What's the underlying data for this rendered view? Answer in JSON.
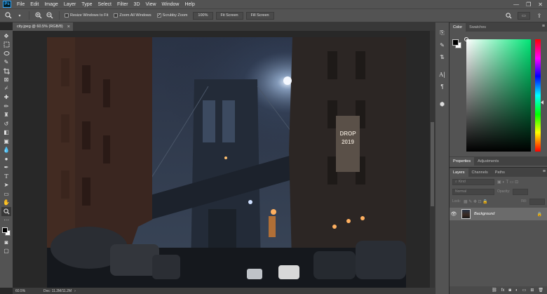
{
  "menubar": {
    "logo": "Ps",
    "items": [
      "File",
      "Edit",
      "Image",
      "Layer",
      "Type",
      "Select",
      "Filter",
      "3D",
      "View",
      "Window",
      "Help"
    ],
    "window_controls": [
      "—",
      "❐",
      "✕"
    ]
  },
  "options": {
    "resize_windows_label": "Resize Windows to Fit",
    "zoom_all_label": "Zoom All Windows",
    "scrubby_zoom_label": "Scrubby Zoom",
    "scrubby_checked": true,
    "zoom_pct_button": "100%",
    "fit_screen_button": "Fit Screen",
    "fill_screen_button": "Fill Screen"
  },
  "document": {
    "tab_label": "city.jpeg @ 60.5% (RGB/8)",
    "zoom_status": "60.5%",
    "doc_status": "Doc: 11.2M/11.2M"
  },
  "color_panel": {
    "tabs": [
      "Color",
      "Swatches"
    ],
    "hue_color": "#00e676"
  },
  "properties_panel": {
    "tabs": [
      "Properties",
      "Adjustments"
    ]
  },
  "layers_panel": {
    "tabs": [
      "Layers",
      "Channels",
      "Paths"
    ],
    "kind_placeholder": "Kind",
    "blend_mode": "Normal",
    "opacity_label": "Opacity:",
    "lock_label": "Lock:",
    "fill_label": "Fill:",
    "layers": [
      {
        "name": "Background",
        "visible": true,
        "locked": true
      }
    ]
  }
}
